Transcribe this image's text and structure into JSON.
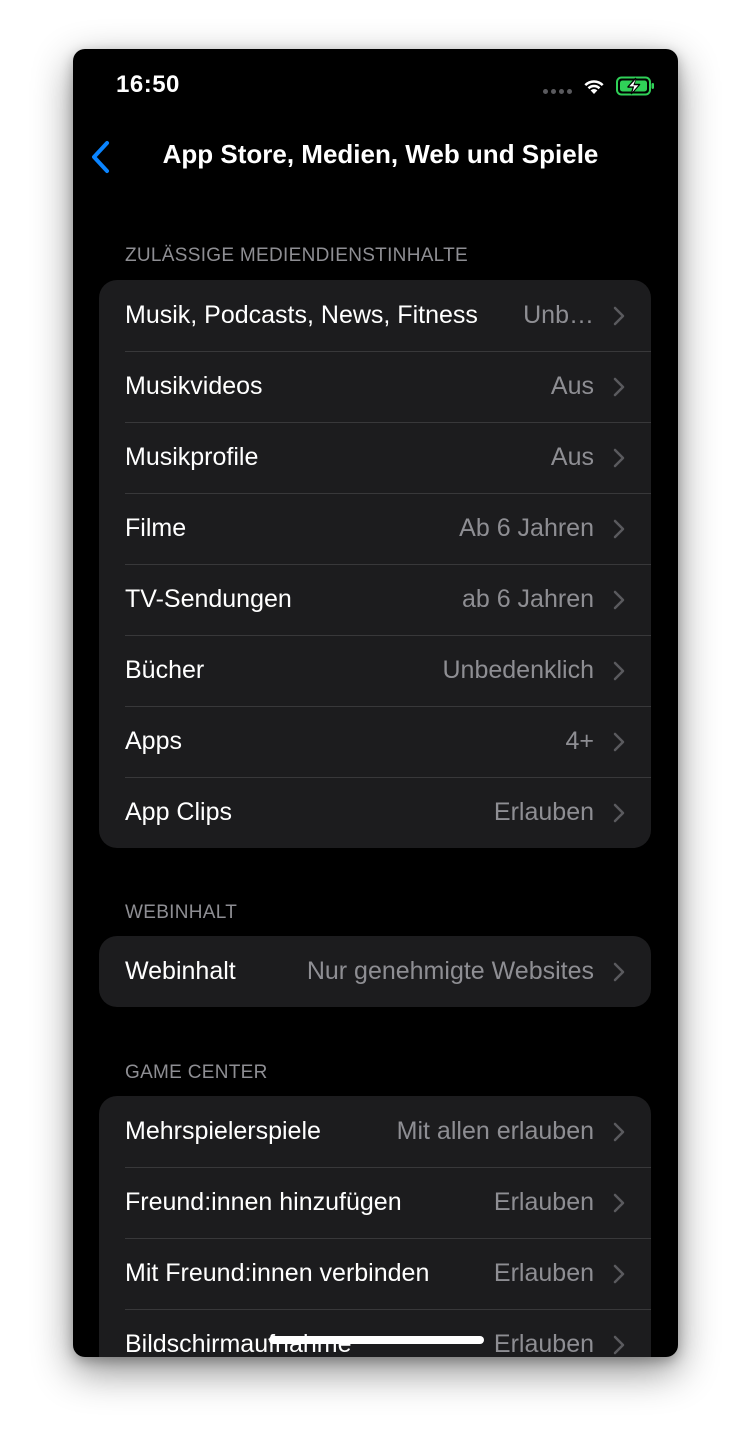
{
  "status_bar": {
    "time": "16:50"
  },
  "nav": {
    "title": "App Store, Medien, Web und Spiele"
  },
  "colors": {
    "accent": "#0a84ff",
    "battery": "#30d158",
    "background": "#000000",
    "cell": "#1c1c1e",
    "secondary_text": "#8e8e93"
  },
  "sections": [
    {
      "header": "ZULÄSSIGE MEDIENDIENSTINHALTE",
      "rows": [
        {
          "label": "Musik, Podcasts, News, Fitness",
          "value": "Unb…"
        },
        {
          "label": "Musikvideos",
          "value": "Aus"
        },
        {
          "label": "Musikprofile",
          "value": "Aus"
        },
        {
          "label": "Filme",
          "value": "Ab 6 Jahren"
        },
        {
          "label": "TV-Sendungen",
          "value": "ab 6 Jahren"
        },
        {
          "label": "Bücher",
          "value": "Unbedenklich"
        },
        {
          "label": "Apps",
          "value": "4+"
        },
        {
          "label": "App Clips",
          "value": "Erlauben"
        }
      ]
    },
    {
      "header": "WEBINHALT",
      "rows": [
        {
          "label": "Webinhalt",
          "value": "Nur genehmigte Websites"
        }
      ]
    },
    {
      "header": "GAME CENTER",
      "rows": [
        {
          "label": "Mehrspielerspiele",
          "value": "Mit allen erlauben"
        },
        {
          "label": "Freund:innen hinzufügen",
          "value": "Erlauben"
        },
        {
          "label": "Mit Freund:innen verbinden",
          "value": "Erlauben"
        },
        {
          "label": "Bildschirmaufnahme",
          "value": "Erlauben"
        }
      ]
    }
  ]
}
